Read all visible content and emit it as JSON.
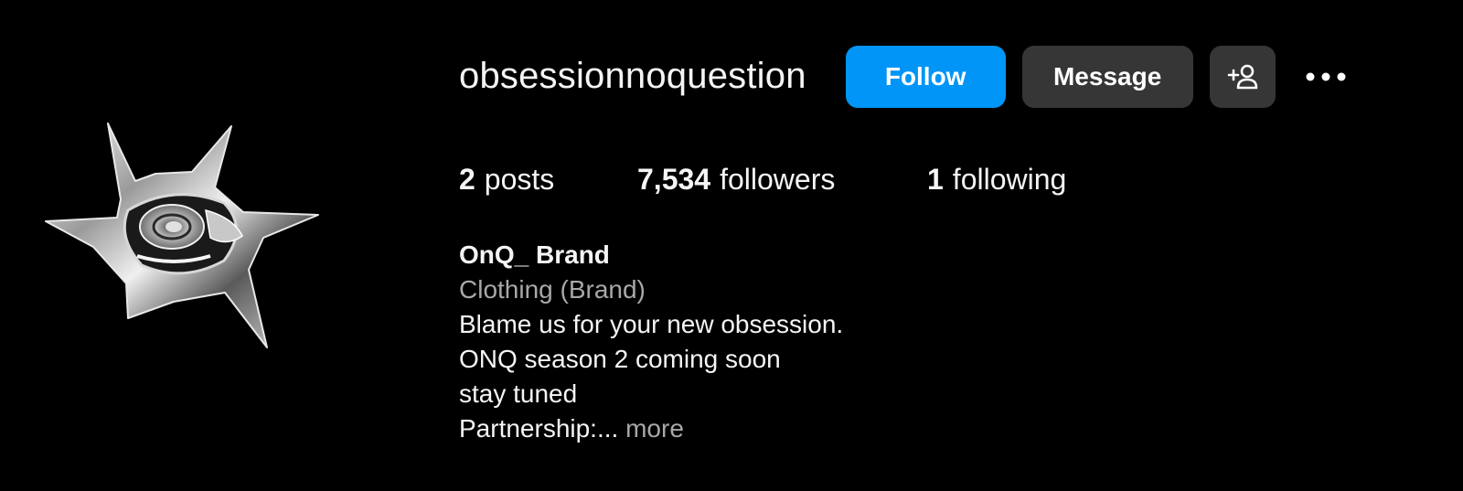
{
  "avatar": {
    "alt": "obsessionnoquestion profile picture"
  },
  "profile": {
    "username": "obsessionnoquestion",
    "follow_label": "Follow",
    "message_label": "Message",
    "add_user_icon": "person-add-icon",
    "more_icon": "more-options-icon"
  },
  "stats": {
    "posts_count": "2",
    "posts_label": "posts",
    "followers_count": "7,534",
    "followers_label": "followers",
    "following_count": "1",
    "following_label": "following"
  },
  "bio": {
    "name": "OnQ_ Brand",
    "category": "Clothing (Brand)",
    "lines": [
      "Blame us for your new obsession.",
      "ONQ season 2 coming soon",
      "stay tuned"
    ],
    "truncated_line": "Partnership:...",
    "more_label": "more"
  },
  "colors": {
    "background": "#000000",
    "follow_button": "#0095f6",
    "secondary_button": "#363636",
    "muted_text": "#a8a8a8"
  }
}
